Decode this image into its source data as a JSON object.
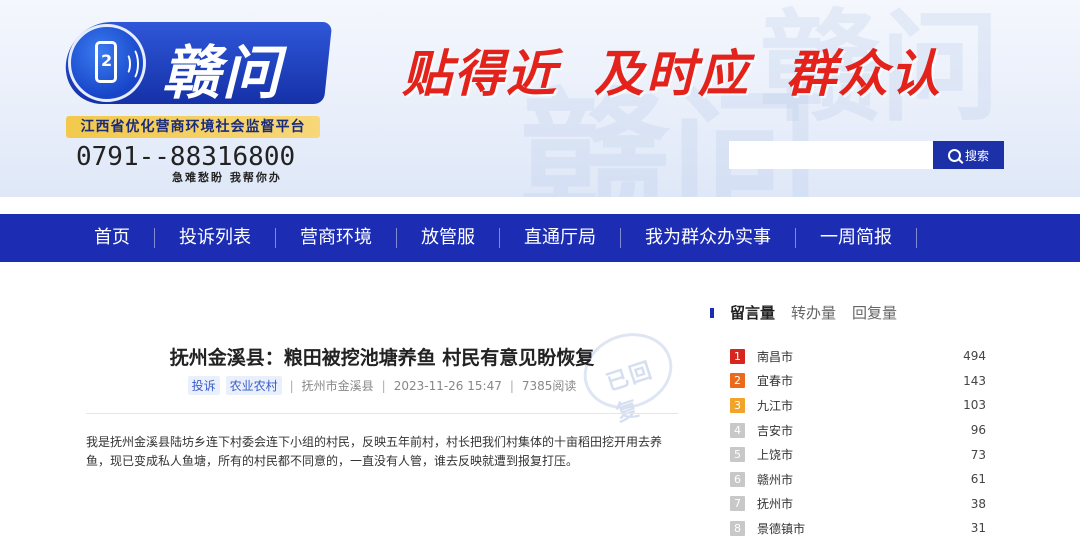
{
  "banner": {
    "logo_text": "赣问",
    "logo_badge": "2",
    "platform_name": "江西省优化营商环境社会监督平台",
    "hotline": "0791--88316800",
    "tagline": "急难愁盼  我帮你办",
    "slogans": [
      "贴得近",
      "及时应",
      "群众认"
    ],
    "search_placeholder": "",
    "search_label": "搜索"
  },
  "nav": {
    "items": [
      {
        "label": "首页"
      },
      {
        "label": "投诉列表"
      },
      {
        "label": "营商环境"
      },
      {
        "label": "放管服"
      },
      {
        "label": "直通厅局"
      },
      {
        "label": "我为群众办实事"
      },
      {
        "label": "一周简报"
      }
    ]
  },
  "article": {
    "title": "抚州金溪县：粮田被挖池塘养鱼 村民有意见盼恢复",
    "stamp": "已回复",
    "tags": [
      "投诉",
      "农业农村"
    ],
    "region": "抚州市金溪县",
    "datetime": "2023-11-26 15:47",
    "reads": "7385阅读",
    "body": "我是抚州金溪县陆坊乡连下村委会连下小组的村民，反映五年前村，村长把我们村集体的十亩稻田挖开用去养鱼，现已变成私人鱼塘，所有的村民都不同意的，一直没有人管，谁去反映就遭到报复打压。"
  },
  "ranking": {
    "tabs": [
      "留言量",
      "转办量",
      "回复量"
    ],
    "active_tab": 0,
    "rows": [
      {
        "rank": "1",
        "city": "南昌市",
        "count": "494",
        "color": "#d7261e"
      },
      {
        "rank": "2",
        "city": "宜春市",
        "count": "143",
        "color": "#ec6a1c"
      },
      {
        "rank": "3",
        "city": "九江市",
        "count": "103",
        "color": "#f2a32a"
      },
      {
        "rank": "4",
        "city": "吉安市",
        "count": "96",
        "color": "#c8c8c8"
      },
      {
        "rank": "5",
        "city": "上饶市",
        "count": "73",
        "color": "#c8c8c8"
      },
      {
        "rank": "6",
        "city": "赣州市",
        "count": "61",
        "color": "#c8c8c8"
      },
      {
        "rank": "7",
        "city": "抚州市",
        "count": "38",
        "color": "#c8c8c8"
      },
      {
        "rank": "8",
        "city": "景德镇市",
        "count": "31",
        "color": "#c8c8c8"
      }
    ]
  }
}
